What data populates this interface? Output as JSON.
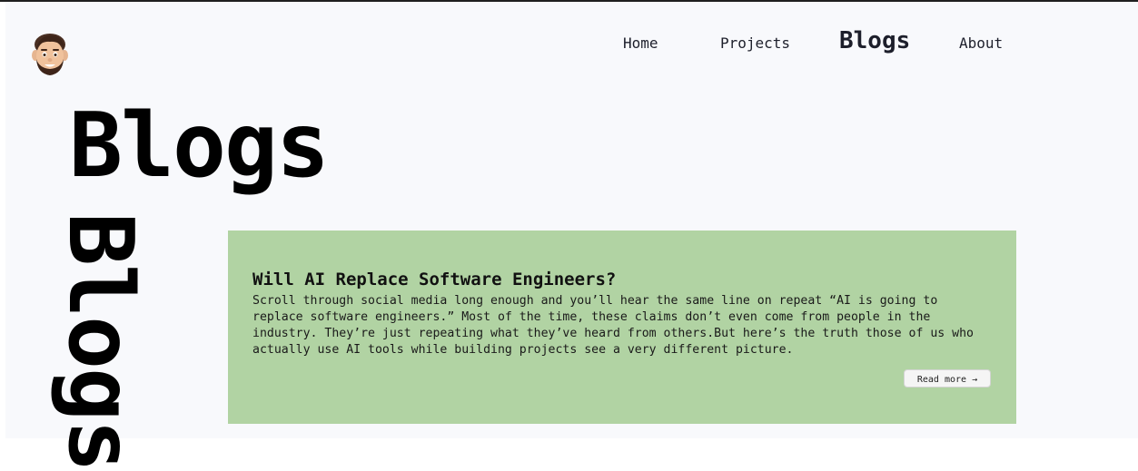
{
  "nav": {
    "items": [
      {
        "label": "Home"
      },
      {
        "label": "Projects"
      },
      {
        "label": "Blogs"
      },
      {
        "label": "About"
      }
    ],
    "active": "Blogs"
  },
  "avatar": {
    "icon": "memoji-avatar-icon"
  },
  "hero": {
    "title": "Blogs",
    "vertical_title": "Blogs"
  },
  "blog_card": {
    "title": "Will AI Replace Software Engineers?",
    "excerpt": "Scroll through social media long enough and you’ll hear the same line on repeat “AI is going to replace software engineers.” Most of the time, these claims don’t even come from people in the industry. They’re just repeating what they’ve heard from others.But here’s the truth those of us who actually use AI tools while building projects see a very different picture.",
    "read_more": "Read more →",
    "background": "#b1d3a3"
  }
}
